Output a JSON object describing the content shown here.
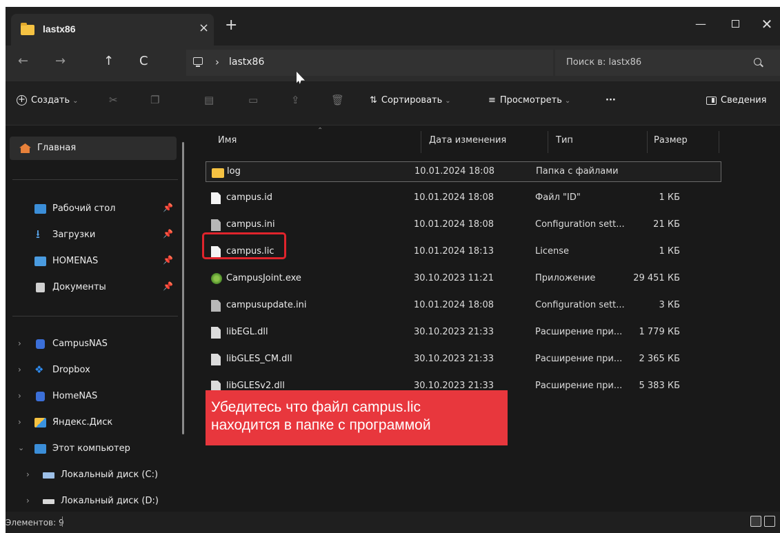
{
  "window": {
    "tab_title": "lastx86",
    "tab_close": "×",
    "new_tab": "+"
  },
  "nav": {
    "back": "←",
    "forward": "→",
    "up": "↑",
    "refresh": "C",
    "crumb_sep": "›",
    "breadcrumb": "lastx86",
    "search_placeholder": "Поиск в: lastx86"
  },
  "commands": {
    "create": "Создать",
    "sort": "Сортировать",
    "view": "Просмотреть",
    "more": "···",
    "details": "Сведения"
  },
  "sidebar": {
    "items": [
      {
        "label": "Главная",
        "icon": "home-icon"
      },
      {
        "label": "Рабочий стол",
        "icon": "desktop-icon",
        "pinned": true
      },
      {
        "label": "Загрузки",
        "icon": "download-icon",
        "pinned": true
      },
      {
        "label": "HOMENAS",
        "icon": "nas-icon",
        "pinned": true
      },
      {
        "label": "Документы",
        "icon": "documents-icon",
        "pinned": true
      },
      {
        "label": "CampusNAS",
        "icon": "drive-icon"
      },
      {
        "label": "Dropbox",
        "icon": "dropbox-icon"
      },
      {
        "label": "HomeNAS",
        "icon": "drive-icon"
      },
      {
        "label": "Яндекс.Диск",
        "icon": "yandex-disk-icon"
      },
      {
        "label": "Этот компьютер",
        "icon": "computer-icon"
      },
      {
        "label": "Локальный диск (C:)",
        "icon": "disk-icon"
      },
      {
        "label": "Локальный диск (D:)",
        "icon": "disk-icon"
      }
    ]
  },
  "columns": {
    "name": "Имя",
    "date": "Дата изменения",
    "type": "Тип",
    "size": "Размер"
  },
  "files": [
    {
      "name": "log",
      "date": "10.01.2024 18:08",
      "type": "Папка с файлами",
      "size": ""
    },
    {
      "name": "campus.id",
      "date": "10.01.2024 18:08",
      "type": "Файл \"ID\"",
      "size": "1 КБ"
    },
    {
      "name": "campus.ini",
      "date": "10.01.2024 18:08",
      "type": "Configuration sett...",
      "size": "21 КБ"
    },
    {
      "name": "campus.lic",
      "date": "10.01.2024 18:13",
      "type": "License",
      "size": "1 КБ"
    },
    {
      "name": "CampusJoint.exe",
      "date": "30.10.2023 11:21",
      "type": "Приложение",
      "size": "29 451 КБ"
    },
    {
      "name": "campusupdate.ini",
      "date": "10.01.2024 18:08",
      "type": "Configuration sett...",
      "size": "3 КБ"
    },
    {
      "name": "libEGL.dll",
      "date": "30.10.2023 21:33",
      "type": "Расширение при...",
      "size": "1 779 КБ"
    },
    {
      "name": "libGLES_CM.dll",
      "date": "30.10.2023 21:33",
      "type": "Расширение при...",
      "size": "2 365 КБ"
    },
    {
      "name": "libGLESv2.dll",
      "date": "30.10.2023 21:33",
      "type": "Расширение при...",
      "size": "5 383 КБ"
    }
  ],
  "callout": {
    "line1": "Убедитесь что файл campus.lic",
    "line2": "находится в папке с программой"
  },
  "status": {
    "item_count": "Элементов: 9"
  },
  "colors": {
    "background": "#191919",
    "callout": "#e8373d",
    "highlight_border": "#e0242c",
    "folder": "#f5c242"
  }
}
